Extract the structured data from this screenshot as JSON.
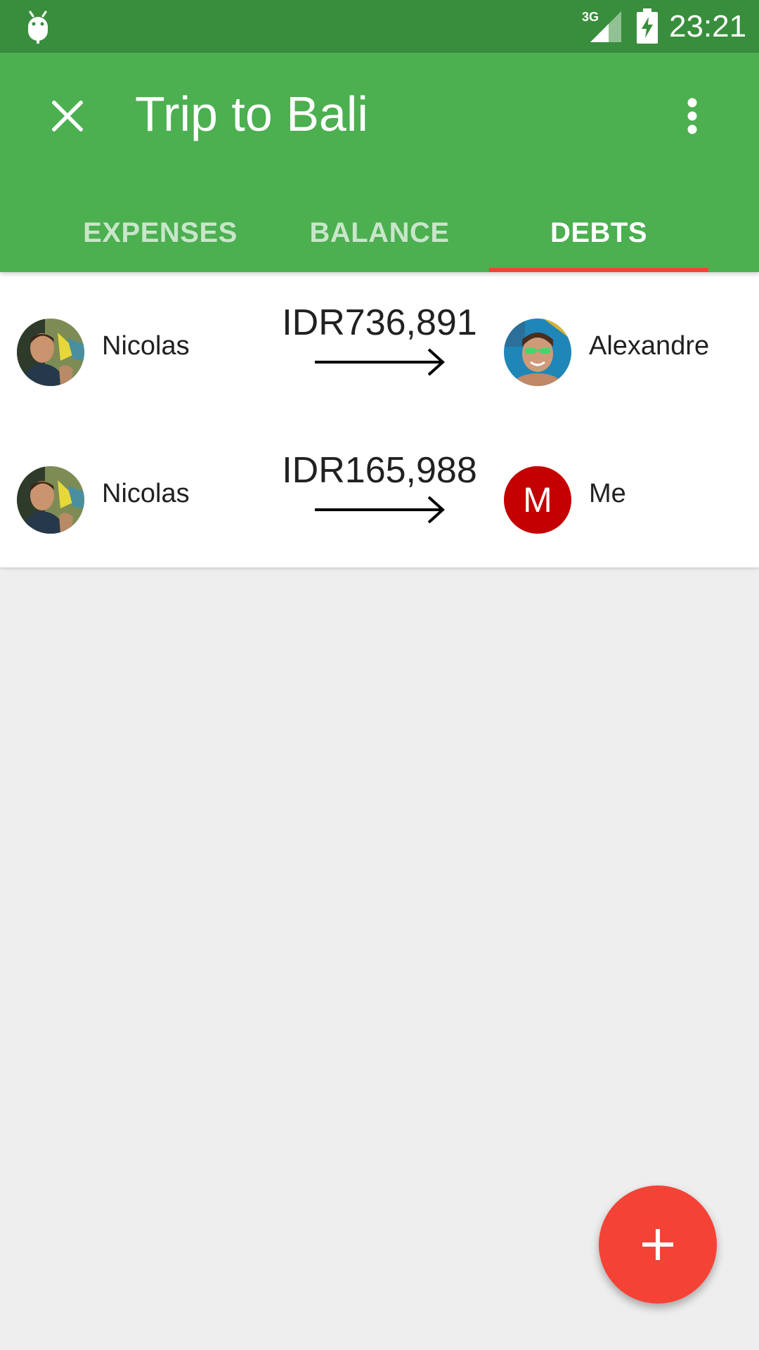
{
  "status_bar": {
    "time": "23:21",
    "network_type": "3G",
    "icons": [
      "android-debug-icon",
      "signal-icon",
      "battery-charging-icon"
    ]
  },
  "toolbar": {
    "title": "Trip to Bali",
    "close_icon": "close-icon",
    "more_icon": "more-vert-icon"
  },
  "tabs": [
    {
      "label": "EXPENSES",
      "active": false
    },
    {
      "label": "BALANCE",
      "active": false
    },
    {
      "label": "DEBTS",
      "active": true
    }
  ],
  "debts": [
    {
      "from": "Nicolas",
      "amount": "IDR736,891",
      "to": "Alexandre"
    },
    {
      "from": "Nicolas",
      "amount": "IDR165,988",
      "to": "Me",
      "to_initial": "M"
    }
  ],
  "fab": {
    "icon": "add-icon"
  },
  "colors": {
    "status_bar": "#388e3c",
    "primary": "#4caf50",
    "accent": "#f44336",
    "avatar_me": "#c40000",
    "background": "#eeeeee"
  }
}
